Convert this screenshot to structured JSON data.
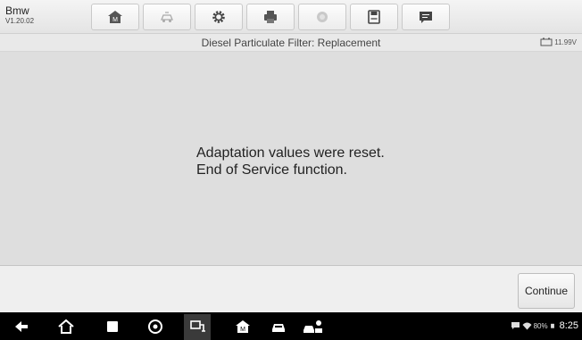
{
  "app": {
    "name": "Bmw",
    "version": "V1.20.02"
  },
  "toolbar": {
    "buttons": [
      {
        "icon": "home-icon"
      },
      {
        "icon": "car-swap-icon"
      },
      {
        "icon": "settings-icon"
      },
      {
        "icon": "print-icon"
      },
      {
        "icon": "help-icon"
      },
      {
        "icon": "save-icon"
      },
      {
        "icon": "message-icon"
      }
    ]
  },
  "titlebar": {
    "title": "Diesel Particulate Filter: Replacement",
    "battery_voltage": "11.99V"
  },
  "content": {
    "message_line1": "Adaptation values were reset.",
    "message_line2": "End of Service function."
  },
  "actions": {
    "continue_label": "Continue"
  },
  "statusbar": {
    "battery_percent": "80%",
    "time": "8:25"
  },
  "colors": {
    "toolbar_bg": "#e8e8e8",
    "content_bg": "#dedede",
    "navbar_bg": "#000000"
  }
}
